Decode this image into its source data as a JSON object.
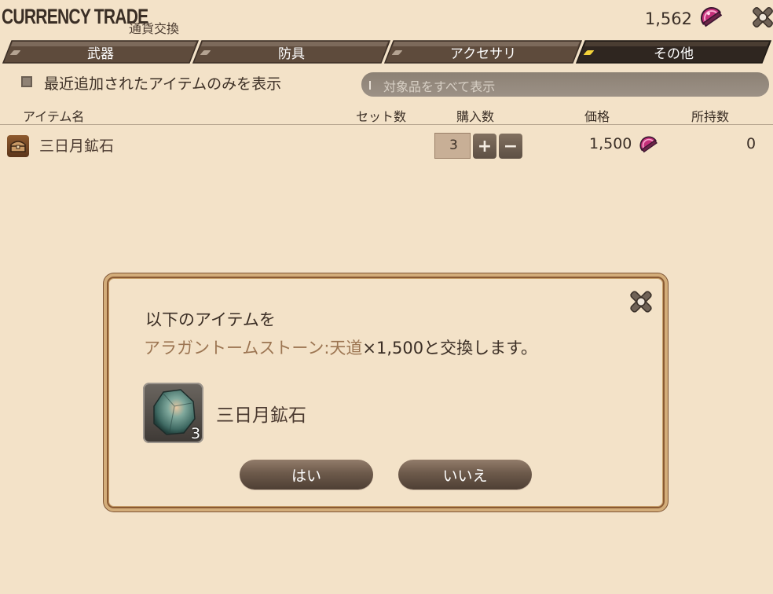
{
  "header": {
    "title": "CURRENCY TRADE",
    "subtitle": "通貨交換",
    "currency_amount": "1,562",
    "currency_icon": "tomestone-icon",
    "close_icon": "close-icon"
  },
  "tabs": [
    {
      "label": "武器",
      "active": false
    },
    {
      "label": "防具",
      "active": false
    },
    {
      "label": "アクセサリ",
      "active": false
    },
    {
      "label": "その他",
      "active": true
    }
  ],
  "filter": {
    "checkbox_label": "最近追加されたアイテムのみを表示",
    "checked": false,
    "dropdown_value": "対象品をすべて表示"
  },
  "table": {
    "columns": [
      "アイテム名",
      "セット数",
      "購入数",
      "価格",
      "所持数"
    ],
    "rows": [
      {
        "name": "三日月鉱石",
        "quantity": "3",
        "plus": "+",
        "minus": "−",
        "price": "1,500",
        "owned": "0"
      }
    ]
  },
  "dialog": {
    "line1": "以下のアイテムを",
    "currency_name": "アラガントームストーン:天道",
    "line2_rest": "×1,500と交換します。",
    "item_name": "三日月鉱石",
    "item_count": "3",
    "yes_label": "はい",
    "no_label": "いいえ"
  },
  "colors": {
    "background": "#f3e2c8",
    "tab_bg": "#5e4b3c",
    "tab_active_bg": "#2f2620",
    "highlight_text": "#9c7552",
    "active_marker": "#f4d33a"
  }
}
